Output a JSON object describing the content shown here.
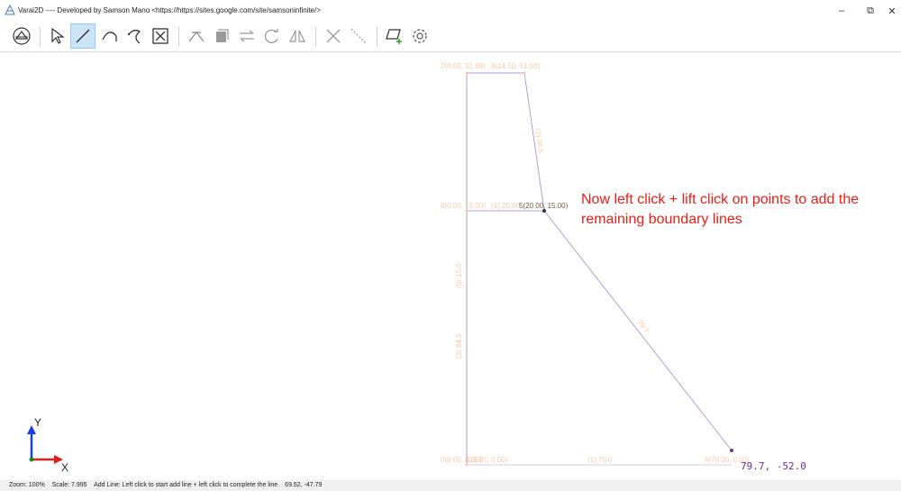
{
  "window": {
    "title": "Varai2D ---- Developed by Samson Mano <https://https://sites.google.com/site/samsoninfinite/>",
    "minimize_glyph": "–",
    "maximize_glyph": "⧉",
    "close_glyph": "✕"
  },
  "toolbar": {
    "buttons": [
      {
        "name": "view-mode-icon",
        "active": false
      },
      {
        "name": "select-icon",
        "active": false
      },
      {
        "name": "add-line-icon",
        "active": true
      },
      {
        "name": "add-arc-icon",
        "active": false
      },
      {
        "name": "add-curve-icon",
        "active": false
      },
      {
        "name": "zoom-fit-icon",
        "active": false
      },
      {
        "name": "trim-icon",
        "active": false
      },
      {
        "name": "fill-icon",
        "active": false
      },
      {
        "name": "mirror-icon",
        "active": false
      },
      {
        "name": "rotate-icon",
        "active": false
      },
      {
        "name": "reflect-icon",
        "active": false
      },
      {
        "name": "delete-icon",
        "active": false
      },
      {
        "name": "divide-line-icon",
        "active": false
      },
      {
        "name": "add-surface-icon",
        "active": false
      },
      {
        "name": "settings-icon",
        "active": false
      }
    ]
  },
  "drawing": {
    "points": [
      {
        "label": "2(0.00, 51.60)"
      },
      {
        "label": "3(14.50, 51.50)"
      },
      {
        "label": "4(0.00, 15.00)"
      },
      {
        "label": "(4) 20.00"
      },
      {
        "label": "5(20.00, 15.00)"
      },
      {
        "label": "0(0.00, 0.00)"
      },
      {
        "label": "1(0.00, 0.00)"
      },
      {
        "label": "6(70.00, 0.00)"
      }
    ],
    "line_lengths": [
      {
        "label": "(2) 36.5"
      },
      {
        "label": "(0) 15.0"
      },
      {
        "label": "(1) 70.0"
      },
      {
        "label": "79.7"
      },
      {
        "label": "(3) 84.5"
      }
    ],
    "cursor_readout": "79.7, -52.0",
    "axis": {
      "x_label": "X",
      "y_label": "Y"
    }
  },
  "annotation": {
    "text": "Now left click + lift click on points to add the remaining boundary lines"
  },
  "status": {
    "zoom": "Zoom: 100%",
    "scale": "Scale: 7.995",
    "mode": "Add Line: Left click to start add line + left click to complete the line",
    "coords": "69.52, -47.79"
  },
  "colors": {
    "accent": "#cce4f7",
    "geometry_line": "#b39ddb",
    "point_label": "#f4c9a8",
    "annotation": "#e8201a",
    "readout": "#6b2e9c"
  }
}
